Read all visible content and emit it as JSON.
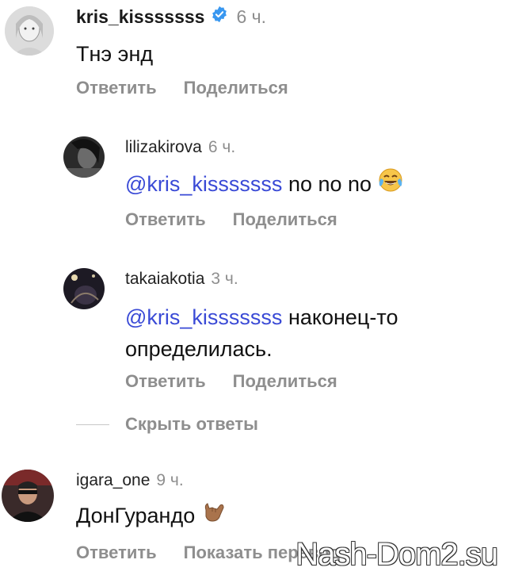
{
  "comments": [
    {
      "username": "kris_kisssssss",
      "time": "6 ч.",
      "text": "Тнэ энд",
      "reply": "Ответить",
      "share": "Поделиться"
    }
  ],
  "replies": [
    {
      "username": "lilizakirova",
      "time": "6 ч.",
      "mention": "@kris_kisssssss",
      "text": "no no no",
      "emoji": "face-with-tears-of-joy",
      "reply": "Ответить",
      "share": "Поделиться"
    },
    {
      "username": "takaiakotia",
      "time": "3 ч.",
      "mention": "@kris_kisssssss",
      "text_line1": "наконец-то",
      "text_line2": "определилась.",
      "reply": "Ответить",
      "share": "Поделиться"
    }
  ],
  "hide_replies": "Скрыть ответы",
  "comment2": {
    "username": "igara_one",
    "time": "9 ч.",
    "text": "ДонГурандо",
    "emoji": "call-me-hand",
    "reply": "Ответить",
    "translate": "Показать перевод"
  },
  "watermark": "Nash-Dom2.su",
  "colors": {
    "mention": "#3a4ad6",
    "muted": "#8e8e8e",
    "verified": "#3897f0"
  }
}
